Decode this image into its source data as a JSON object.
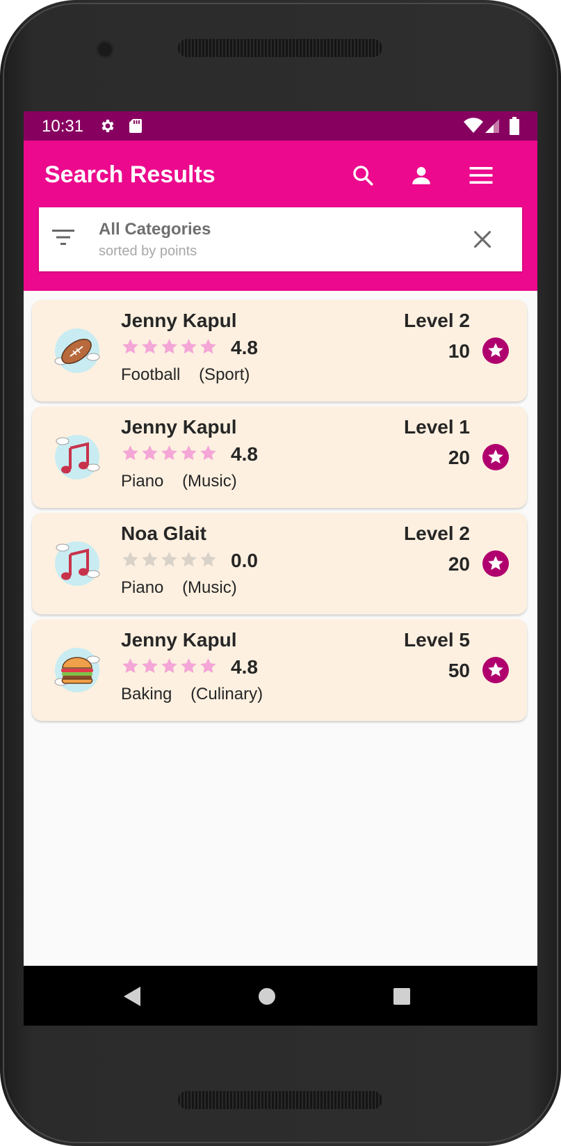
{
  "status_bar": {
    "time": "10:31",
    "icons": [
      "gear-icon",
      "sd-card-icon",
      "wifi-icon",
      "signal-icon",
      "battery-icon"
    ]
  },
  "app_bar": {
    "title": "Search Results",
    "actions": [
      "search-icon",
      "account-icon",
      "menu-icon"
    ],
    "color": "#ec098d",
    "status_color": "#870060"
  },
  "filter": {
    "title": "All Categories",
    "subtitle": "sorted by points"
  },
  "results": [
    {
      "name": "Jenny Kapul",
      "rating": "4.8",
      "stars_filled": 5,
      "skill": "Football",
      "category": "(Sport)",
      "level": "Level 2",
      "points": "10",
      "icon": "football-icon"
    },
    {
      "name": "Jenny Kapul",
      "rating": "4.8",
      "stars_filled": 5,
      "skill": "Piano",
      "category": "(Music)",
      "level": "Level 1",
      "points": "20",
      "icon": "music-note-icon"
    },
    {
      "name": "Noa Glait",
      "rating": "0.0",
      "stars_filled": 0,
      "skill": "Piano",
      "category": "(Music)",
      "level": "Level 2",
      "points": "20",
      "icon": "music-note-icon"
    },
    {
      "name": "Jenny Kapul",
      "rating": "4.8",
      "stars_filled": 5,
      "skill": "Baking",
      "category": "(Culinary)",
      "level": "Level 5",
      "points": "50",
      "icon": "burger-icon"
    }
  ],
  "colors": {
    "card_bg": "#fdf0e0",
    "star_filled": "#f4a6d7",
    "star_empty": "#d9d2c9",
    "points_badge": "#b0006e"
  },
  "nav_bar": [
    "back-icon",
    "home-icon",
    "recents-icon"
  ]
}
